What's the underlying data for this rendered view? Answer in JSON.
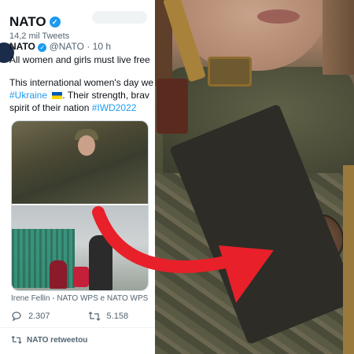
{
  "account": {
    "name": "NATO",
    "tweet_count": "14,2 mil Tweets"
  },
  "tweet": {
    "author": "NATO",
    "handle": "@NATO",
    "time": "· 10 h",
    "line1": "All women and girls must live free",
    "line2": "This international women's day we",
    "line3_hashtag": "#Ukraine",
    "line3_rest": ". Their strength, brav",
    "line4_start": "spirit of their nation ",
    "line4_hashtag": "#IWD2022",
    "caption": "Irene Fellin - NATO WPS e NATO WPS",
    "reply_count": "2.307",
    "retweet_count": "5.158"
  },
  "next_item": {
    "label": "NATO retweetou"
  },
  "icons": {
    "verified": "verified-badge-icon",
    "reply": "reply-icon",
    "retweet": "retweet-icon",
    "flag": "ukraine-flag-emoji"
  },
  "colors": {
    "accent": "#1d9bf0",
    "arrow": "#e8202a"
  }
}
